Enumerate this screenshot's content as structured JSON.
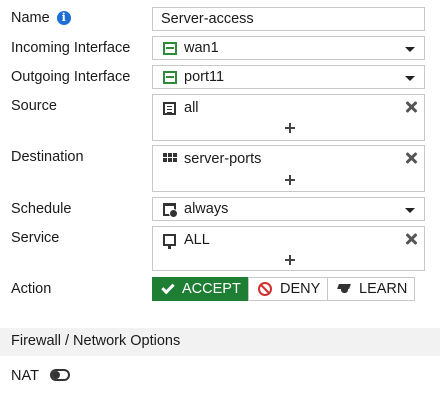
{
  "form": {
    "name": {
      "label": "Name",
      "value": "Server-access"
    },
    "incoming_interface": {
      "label": "Incoming Interface",
      "value": "wan1",
      "icon": "interface-port-icon"
    },
    "outgoing_interface": {
      "label": "Outgoing Interface",
      "value": "port11",
      "icon": "interface-port-icon"
    },
    "source": {
      "label": "Source",
      "value": "all",
      "icon": "address-list-icon"
    },
    "destination": {
      "label": "Destination",
      "value": "server-ports",
      "icon": "address-group-icon"
    },
    "schedule": {
      "label": "Schedule",
      "value": "always",
      "icon": "calendar-clock-icon"
    },
    "service": {
      "label": "Service",
      "value": "ALL",
      "icon": "service-icon"
    },
    "action": {
      "label": "Action",
      "options": [
        "ACCEPT",
        "DENY",
        "LEARN"
      ],
      "selected": "ACCEPT"
    }
  },
  "section": {
    "title": "Firewall / Network Options"
  },
  "nat": {
    "label": "NAT",
    "enabled": false
  },
  "colors": {
    "accept_green": "#1e7e34",
    "deny_red": "#d0312d",
    "info_blue": "#1d6fd6",
    "interface_green": "#2e8b3a"
  }
}
